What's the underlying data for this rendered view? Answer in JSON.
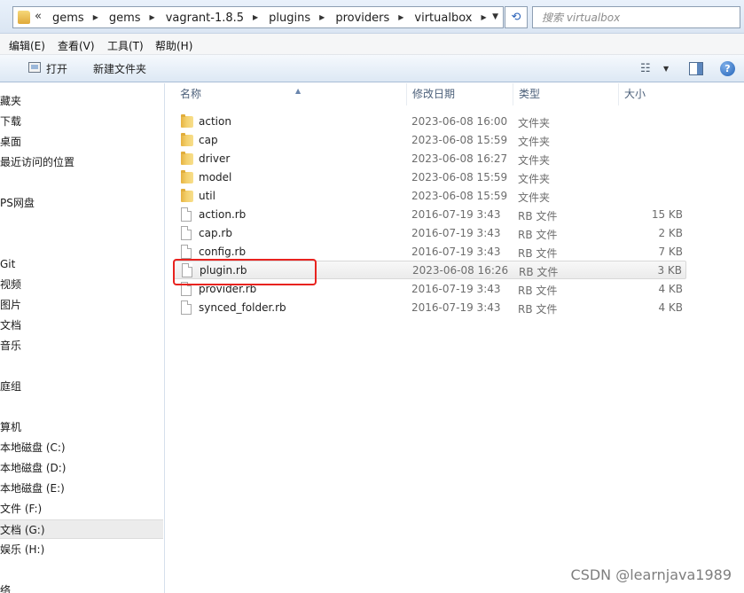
{
  "address_bar": {
    "overflow_chevron": "«",
    "breadcrumbs": [
      "gems",
      "gems",
      "vagrant-1.8.5",
      "plugins",
      "providers",
      "virtualbox"
    ],
    "separator": "▶",
    "search_placeholder": "搜索 virtualbox"
  },
  "menu": {
    "items": [
      "编辑(E)",
      "查看(V)",
      "工具(T)",
      "帮助(H)"
    ]
  },
  "toolbar": {
    "open_label": "打开",
    "new_folder_label": "新建文件夹",
    "views_icon": "views-icon",
    "views_glyph": "☷"
  },
  "nav": {
    "items": [
      "藏夹",
      "下载",
      "桌面",
      "最近访问的位置",
      "PS网盘",
      "Git",
      "视频",
      "图片",
      "文档",
      "音乐",
      "庭组",
      "算机",
      "本地磁盘 (C:)",
      "本地磁盘 (D:)",
      "本地磁盘 (E:)",
      "文件 (F:)",
      "文档 (G:)",
      "娱乐 (H:)",
      "络"
    ],
    "selected": "文档 (G:)"
  },
  "columns": {
    "name": "名称",
    "modified": "修改日期",
    "type": "类型",
    "size": "大小"
  },
  "files": [
    {
      "name": "action",
      "modified": "2023-06-08 16:00",
      "type": "文件夹",
      "size": "",
      "kind": "folder"
    },
    {
      "name": "cap",
      "modified": "2023-06-08 15:59",
      "type": "文件夹",
      "size": "",
      "kind": "folder"
    },
    {
      "name": "driver",
      "modified": "2023-06-08 16:27",
      "type": "文件夹",
      "size": "",
      "kind": "folder"
    },
    {
      "name": "model",
      "modified": "2023-06-08 15:59",
      "type": "文件夹",
      "size": "",
      "kind": "folder"
    },
    {
      "name": "util",
      "modified": "2023-06-08 15:59",
      "type": "文件夹",
      "size": "",
      "kind": "folder"
    },
    {
      "name": "action.rb",
      "modified": "2016-07-19 3:43",
      "type": "RB 文件",
      "size": "15 KB",
      "kind": "file"
    },
    {
      "name": "cap.rb",
      "modified": "2016-07-19 3:43",
      "type": "RB 文件",
      "size": "2 KB",
      "kind": "file"
    },
    {
      "name": "config.rb",
      "modified": "2016-07-19 3:43",
      "type": "RB 文件",
      "size": "7 KB",
      "kind": "file"
    },
    {
      "name": "plugin.rb",
      "modified": "2023-06-08 16:26",
      "type": "RB 文件",
      "size": "3 KB",
      "kind": "file"
    },
    {
      "name": "provider.rb",
      "modified": "2016-07-19 3:43",
      "type": "RB 文件",
      "size": "4 KB",
      "kind": "file"
    },
    {
      "name": "synced_folder.rb",
      "modified": "2016-07-19 3:43",
      "type": "RB 文件",
      "size": "4 KB",
      "kind": "file"
    }
  ],
  "hovered_file": "plugin.rb",
  "highlight_color": "#e8231f",
  "watermark": "CSDN @learnjava1989"
}
